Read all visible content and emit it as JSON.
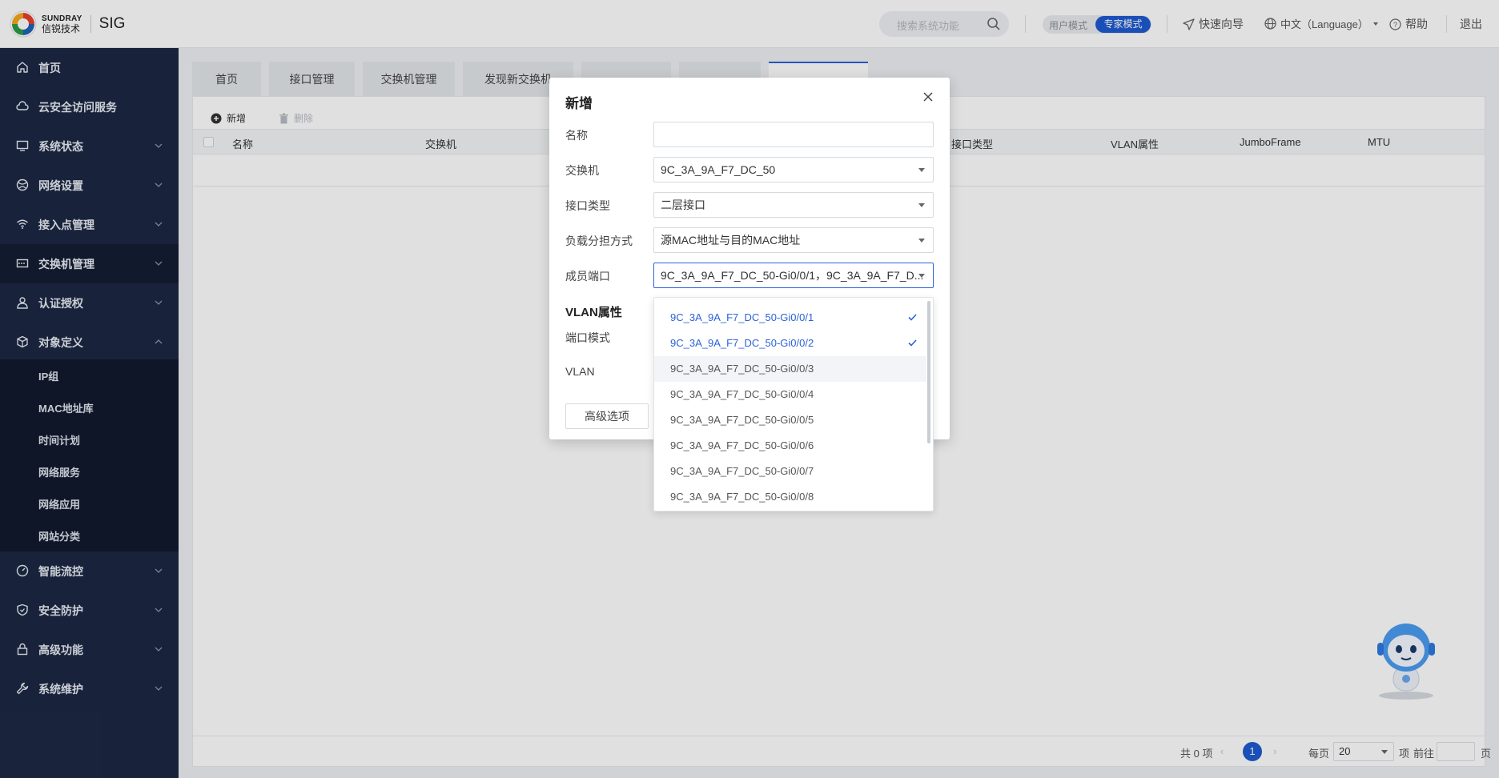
{
  "header": {
    "brand_en": "SUNDRAY",
    "brand_cn": "信锐技术",
    "product": "SIG",
    "search_placeholder": "搜索系统功能",
    "mode_user": "用户模式",
    "mode_expert": "专家模式",
    "quick_guide": "快速向导",
    "language": "中文（Language）",
    "help": "帮助",
    "logout": "退出",
    "logo_colors": [
      "#e8412c",
      "#f4a81d",
      "#2b9a48",
      "#1f63b5"
    ]
  },
  "sidebar": {
    "items": [
      {
        "label": "首页",
        "icon": "home-icon"
      },
      {
        "label": "云安全访问服务",
        "icon": "cloud-icon"
      },
      {
        "label": "系统状态",
        "icon": "monitor-icon"
      },
      {
        "label": "网络设置",
        "icon": "globe-icon"
      },
      {
        "label": "接入点管理",
        "icon": "wifi-icon"
      },
      {
        "label": "交换机管理",
        "icon": "switch-icon"
      },
      {
        "label": "认证授权",
        "icon": "user-icon"
      },
      {
        "label": "对象定义",
        "icon": "cube-icon"
      },
      {
        "label": "智能流控",
        "icon": "gauge-icon"
      },
      {
        "label": "安全防护",
        "icon": "shield-icon"
      },
      {
        "label": "高级功能",
        "icon": "lock-icon"
      },
      {
        "label": "系统维护",
        "icon": "wrench-icon"
      }
    ],
    "sub_items": [
      "IP组",
      "MAC地址库",
      "时间计划",
      "网络服务",
      "网络应用",
      "网站分类"
    ]
  },
  "tabs": [
    "首页",
    "接口管理",
    "交换机管理",
    "发现新交换机",
    "",
    "",
    ""
  ],
  "toolbar": {
    "add": "新增",
    "delete": "删除"
  },
  "table": {
    "columns": [
      "名称",
      "交换机",
      "接口类型",
      "VLAN属性",
      "JumboFrame",
      "MTU"
    ]
  },
  "pagination": {
    "total": "共 0 项",
    "current_page": "1",
    "per_page_label": "每页",
    "per_page_value": "20",
    "item_unit": "项",
    "goto_label": "前往",
    "page_unit": "页"
  },
  "modal": {
    "title": "新增",
    "fields": {
      "name_label": "名称",
      "name_value": "",
      "switch_label": "交换机",
      "switch_value": "9C_3A_9A_F7_DC_50",
      "iftype_label": "接口类型",
      "iftype_value": "二层接口",
      "lb_label": "负载分担方式",
      "lb_value": "源MAC地址与目的MAC地址",
      "member_label": "成员端口",
      "member_value": "9C_3A_9A_F7_DC_50-Gi0/0/1，9C_3A_9A_F7_D..."
    },
    "vlan_section": "VLAN属性",
    "port_mode_label": "端口模式",
    "vlan_label": "VLAN",
    "advanced": "高级选项"
  },
  "dropdown": {
    "options": [
      {
        "label": "9C_3A_9A_F7_DC_50-Gi0/0/1",
        "selected": true
      },
      {
        "label": "9C_3A_9A_F7_DC_50-Gi0/0/2",
        "selected": true
      },
      {
        "label": "9C_3A_9A_F7_DC_50-Gi0/0/3",
        "selected": false
      },
      {
        "label": "9C_3A_9A_F7_DC_50-Gi0/0/4",
        "selected": false
      },
      {
        "label": "9C_3A_9A_F7_DC_50-Gi0/0/5",
        "selected": false
      },
      {
        "label": "9C_3A_9A_F7_DC_50-Gi0/0/6",
        "selected": false
      },
      {
        "label": "9C_3A_9A_F7_DC_50-Gi0/0/7",
        "selected": false
      },
      {
        "label": "9C_3A_9A_F7_DC_50-Gi0/0/8",
        "selected": false
      }
    ]
  },
  "colors": {
    "sidebar_bg": "#1c2844",
    "accent": "#1e5ad1"
  }
}
